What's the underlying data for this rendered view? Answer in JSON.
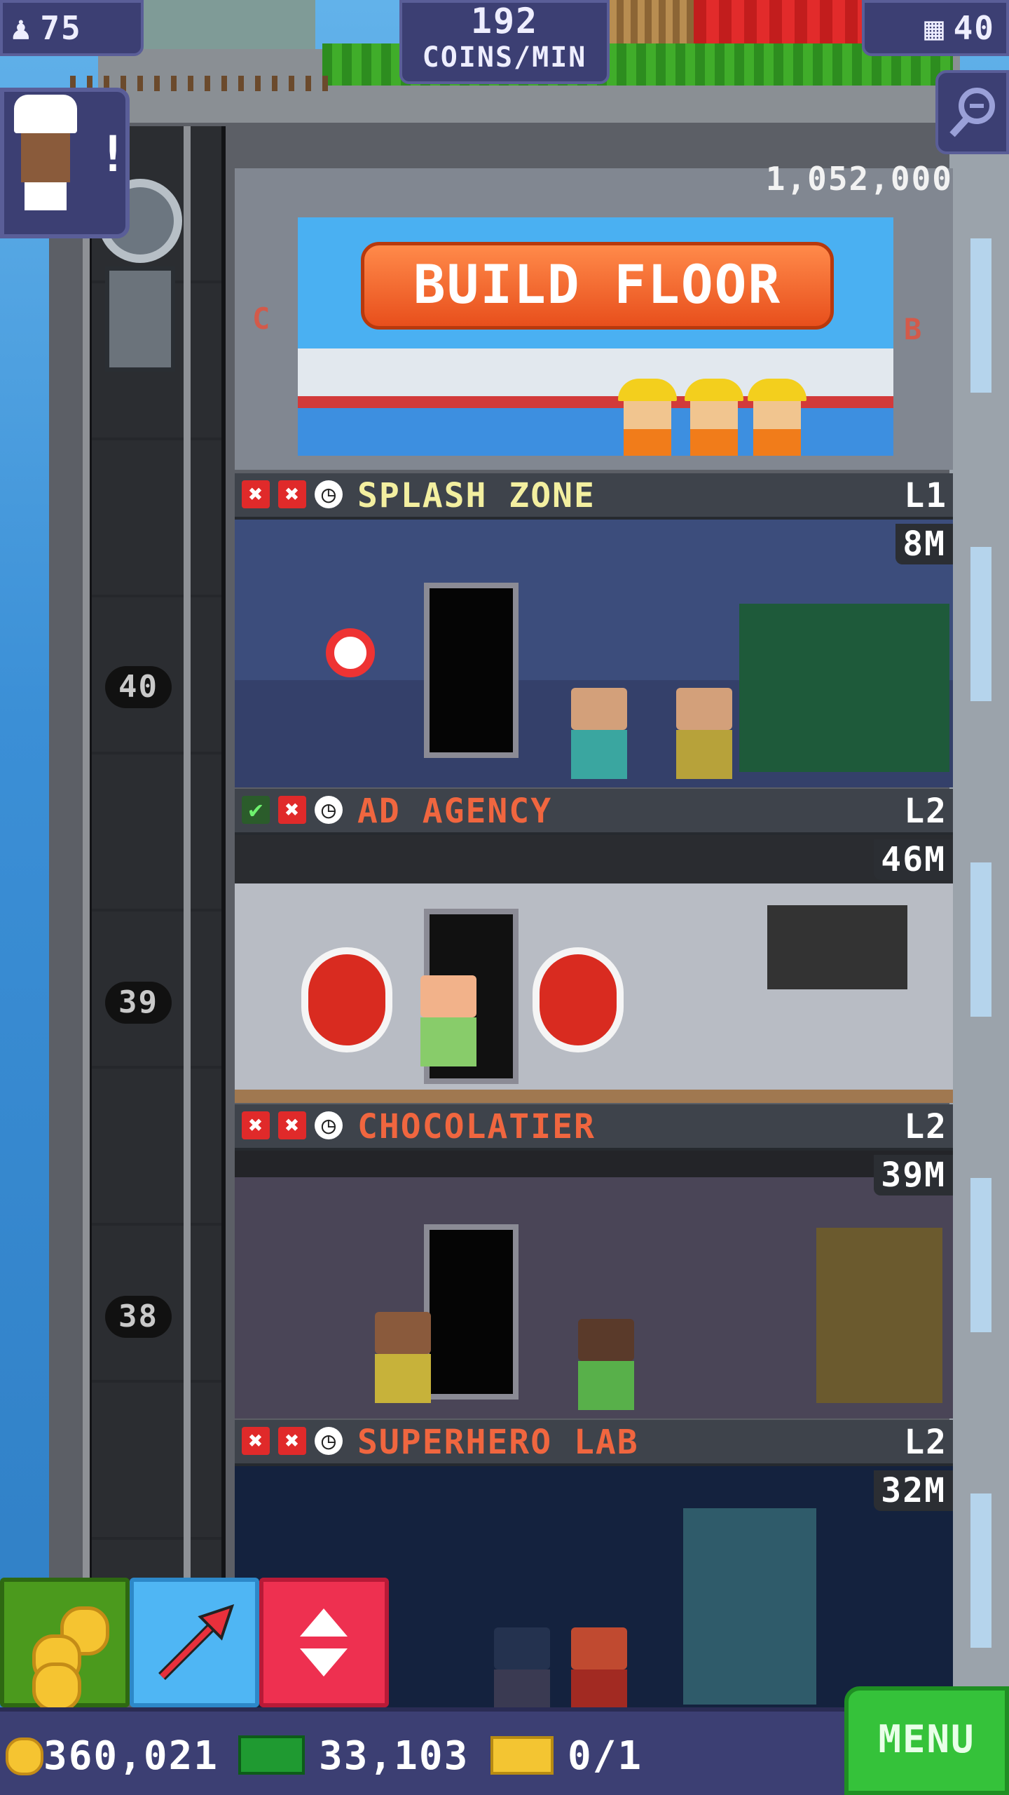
{
  "hud": {
    "population": "75",
    "coins_per_min_value": "192",
    "coins_per_min_label": "COINS/MIN",
    "floors_count": "40"
  },
  "build_floor": {
    "cost": "1,052,000",
    "button_label": "BUILD FLOOR",
    "markers": [
      "C",
      "B"
    ]
  },
  "elevator": {
    "floor_numbers": [
      "40",
      "39",
      "38"
    ]
  },
  "floors": [
    {
      "name": "SPLASH ZONE",
      "level": "L1",
      "value": "8M",
      "name_color": "#f3efa0",
      "statuses": [
        "x",
        "x",
        "clock"
      ]
    },
    {
      "name": "AD AGENCY",
      "level": "L2",
      "value": "46M",
      "name_color": "#f0663f",
      "statuses": [
        "check",
        "x",
        "clock"
      ]
    },
    {
      "name": "CHOCOLATIER",
      "level": "L2",
      "value": "39M",
      "name_color": "#f0663f",
      "statuses": [
        "x",
        "x",
        "clock"
      ]
    },
    {
      "name": "SUPERHERO LAB",
      "level": "L2",
      "value": "32M",
      "name_color": "#f0663f",
      "statuses": [
        "x",
        "x",
        "clock"
      ]
    }
  ],
  "bottom_bar": {
    "coins": "360,021",
    "bux": "33,103",
    "tickets": "0/1",
    "menu_label": "MENU"
  },
  "chef_alert": "!",
  "icons": {
    "population": "person-icon",
    "floors": "building-icon",
    "zoom": "zoom-out-icon",
    "coins": "coin-icon",
    "bux": "bux-icon",
    "ticket": "ticket-icon",
    "pick": "arrow-icon",
    "elevator": "elevator-arrows-icon"
  }
}
